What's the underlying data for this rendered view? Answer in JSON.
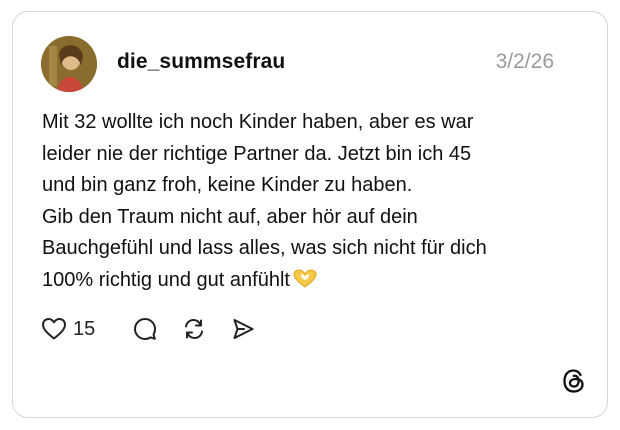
{
  "post": {
    "username": "die_summsefrau",
    "date": "3/2/26",
    "text_lines": [
      "Mit 32 wollte ich noch Kinder haben, aber es war",
      "leider nie der richtige Partner da. Jetzt bin ich 45",
      "und bin ganz froh, keine Kinder zu haben.",
      "Gib den Traum nicht auf, aber hör auf dein",
      "Bauchgefühl und lass alles, was sich nicht für dich",
      "100% richtig und gut anfühlt"
    ],
    "emoji": "heart-hands-emoji"
  },
  "actions": {
    "like_count": "15",
    "icons": [
      "heart-icon",
      "comment-icon",
      "repost-icon",
      "share-icon"
    ]
  },
  "branding": {
    "logo": "threads-logo-icon"
  }
}
